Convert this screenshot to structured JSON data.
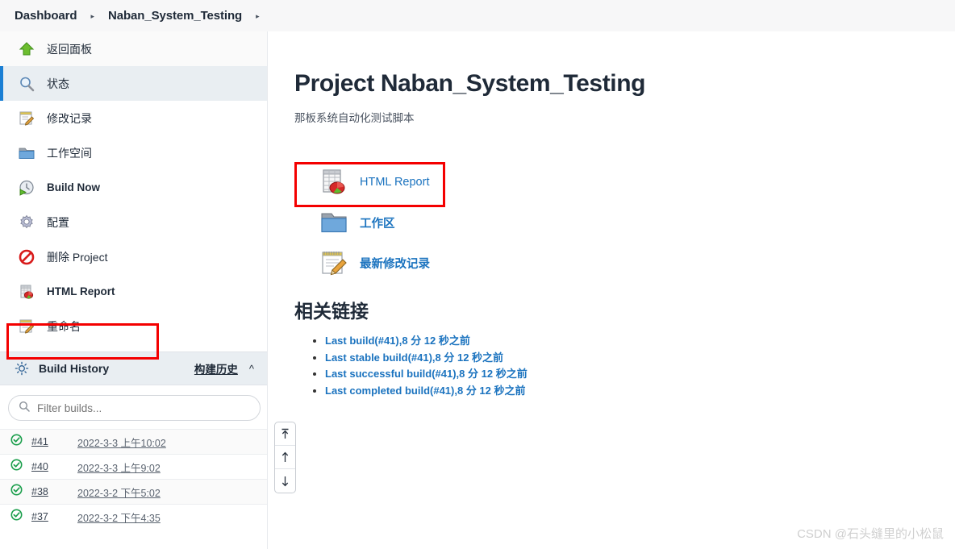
{
  "breadcrumb": {
    "items": [
      {
        "label": "Dashboard"
      },
      {
        "label": "Naban_System_Testing"
      }
    ],
    "separator": "▸"
  },
  "sidebar": {
    "items": [
      {
        "label": "返回面板",
        "icon": "up-arrow-icon",
        "selected": false
      },
      {
        "label": "状态",
        "icon": "magnifier-icon",
        "selected": true
      },
      {
        "label": "修改记录",
        "icon": "notepad-pencil-icon",
        "selected": false
      },
      {
        "label": "工作空间",
        "icon": "folder-icon",
        "selected": false
      },
      {
        "label": "Build Now",
        "icon": "build-clock-icon",
        "selected": false
      },
      {
        "label": "配置",
        "icon": "gear-icon",
        "selected": false
      },
      {
        "label": "删除 Project",
        "icon": "no-entry-icon",
        "selected": false
      },
      {
        "label": "HTML Report",
        "icon": "html-report-icon",
        "selected": false
      },
      {
        "label": "重命名",
        "icon": "notepad-pencil-icon",
        "selected": false
      }
    ]
  },
  "build_history": {
    "title": "Build History",
    "icon": "sun-gear-icon",
    "link_label": "构建历史",
    "collapse_icon": "chevron-up-icon",
    "filter": {
      "placeholder": "Filter builds...",
      "value": "",
      "icon": "search-icon"
    },
    "rows": [
      {
        "status": "success",
        "number": "#41",
        "time": "2022-3-3 上午10:02"
      },
      {
        "status": "success",
        "number": "#40",
        "time": "2022-3-3 上午9:02"
      },
      {
        "status": "success",
        "number": "#38",
        "time": "2022-3-2 下午5:02"
      },
      {
        "status": "success",
        "number": "#37",
        "time": "2022-3-2 下午4:35"
      }
    ]
  },
  "main": {
    "title": "Project Naban_System_Testing",
    "description": "那板系统自动化测试脚本",
    "actions": [
      {
        "label": "HTML Report",
        "icon": "html-report-icon",
        "highlighted": true
      },
      {
        "label": "工作区",
        "icon": "folder-icon",
        "highlighted": false
      },
      {
        "label": "最新修改记录",
        "icon": "notepad-pencil-icon",
        "highlighted": false
      }
    ],
    "related_links_title": "相关链接",
    "related_links": [
      {
        "label": "Last build(#41),8 分 12 秒之前"
      },
      {
        "label": "Last stable build(#41),8 分 12 秒之前"
      },
      {
        "label": "Last successful build(#41),8 分 12 秒之前"
      },
      {
        "label": "Last completed build(#41),8 分 12 秒之前"
      }
    ]
  },
  "scroll_buttons": [
    {
      "icon": "scroll-to-top-icon",
      "glyph": "↥"
    },
    {
      "icon": "scroll-up-icon",
      "glyph": "↑"
    },
    {
      "icon": "scroll-down-icon",
      "glyph": "↓"
    }
  ],
  "watermark": "CSDN @石头缝里的小松鼠",
  "colors": {
    "accent_blue": "#1b7fd4",
    "link_blue": "#1b73bf",
    "highlight_red": "#f40000",
    "success_green": "#1a9e4b",
    "sidebar_selected_bg": "#e9eef2"
  }
}
